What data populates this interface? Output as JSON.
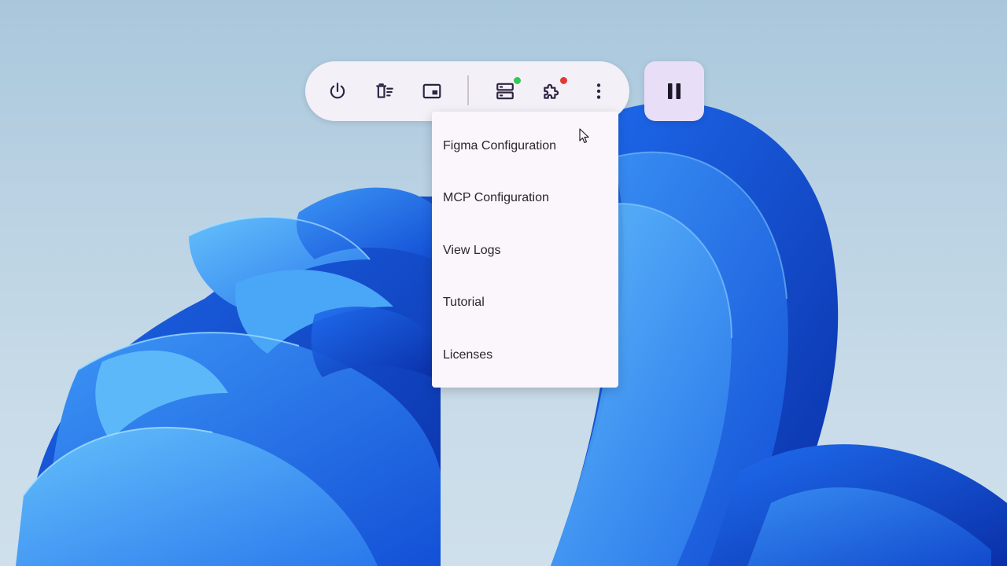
{
  "toolbar": {
    "buttons": [
      {
        "name": "power",
        "icon": "power-icon"
      },
      {
        "name": "clear-list",
        "icon": "delete-list-icon"
      },
      {
        "name": "picture-in-picture",
        "icon": "picture-in-picture-icon"
      },
      {
        "name": "servers",
        "icon": "server-icon",
        "status_color": "#34c759"
      },
      {
        "name": "extensions",
        "icon": "puzzle-icon",
        "status_color": "#e53935"
      },
      {
        "name": "more",
        "icon": "more-vert-icon"
      }
    ],
    "icon_color": "#2c2542",
    "background": "#f4f0f8"
  },
  "pause_button": {
    "icon": "pause-icon",
    "background": "#e9def8"
  },
  "menu": {
    "items": [
      {
        "label": "Figma Configuration"
      },
      {
        "label": "MCP Configuration"
      },
      {
        "label": "View Logs"
      },
      {
        "label": "Tutorial"
      },
      {
        "label": "Licenses"
      }
    ]
  },
  "colors": {
    "wallpaper_blue": "#1f63e6",
    "wallpaper_light": "#46a8f5",
    "menu_background": "#faf6fb"
  }
}
